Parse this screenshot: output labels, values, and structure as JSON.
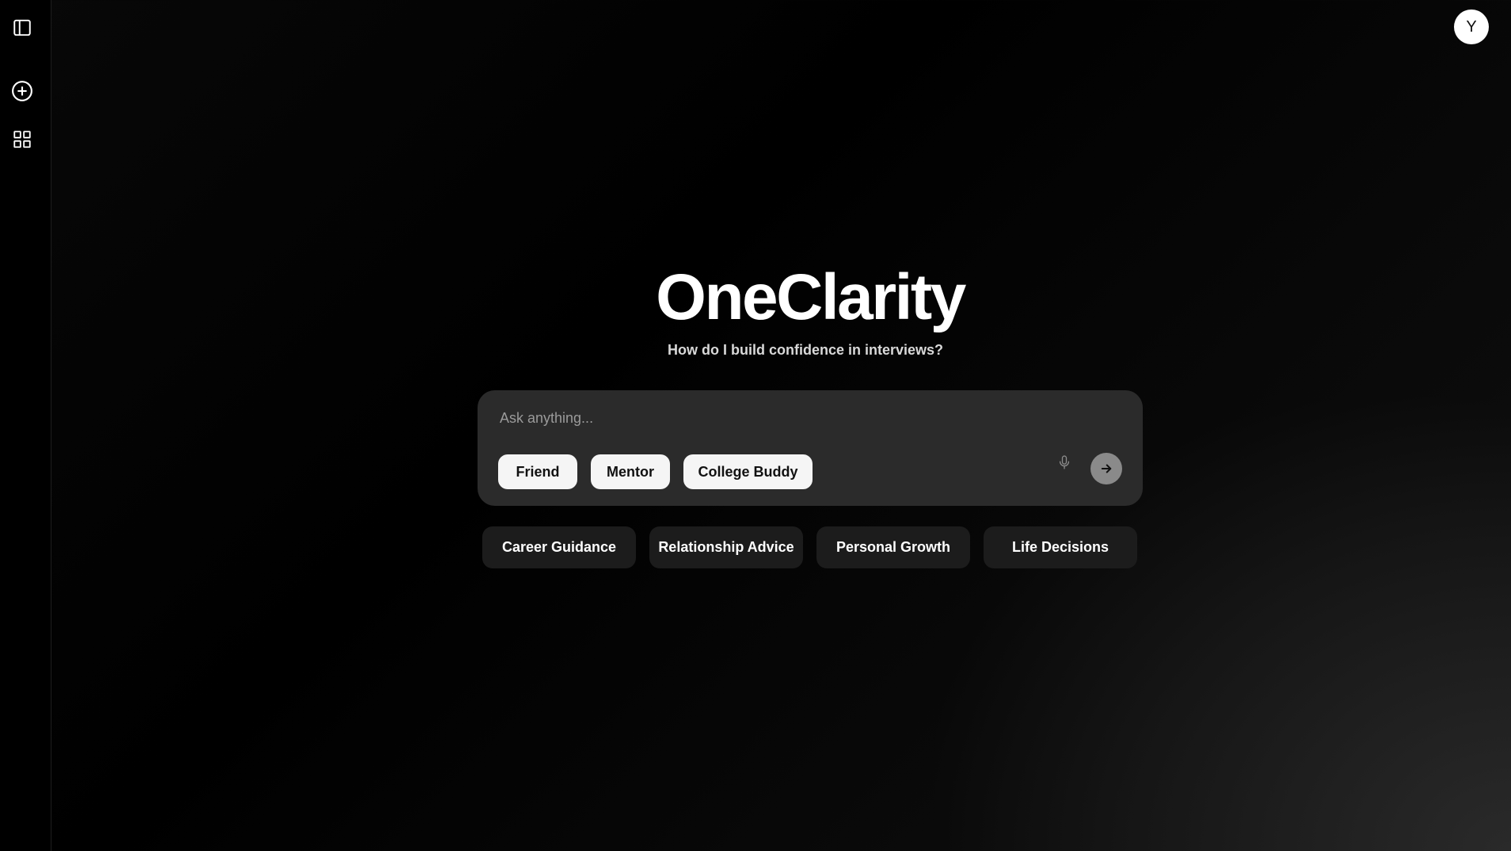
{
  "sidebar": {
    "items": [
      {
        "icon": "sidebar-toggle-icon"
      },
      {
        "icon": "plus-circle-icon"
      },
      {
        "icon": "grid-icon"
      }
    ]
  },
  "user": {
    "avatar_initial": "Y"
  },
  "hero": {
    "title": "OneClarity",
    "subtitle": "How do I build confidence in interviews?"
  },
  "composer": {
    "placeholder": "Ask anything...",
    "value": "",
    "personas": [
      "Friend",
      "Mentor",
      "College Buddy"
    ],
    "mic_icon": "microphone-icon",
    "send_icon": "arrow-right-icon"
  },
  "topics": [
    "Career Guidance",
    "Relationship Advice",
    "Personal Growth",
    "Life Decisions"
  ],
  "colors": {
    "background": "#000000",
    "composer_bg": "#2b2b2b",
    "persona_bg": "#f5f5f5",
    "topic_bg": "#1c1c1c",
    "send_bg": "#8a8a8a"
  }
}
